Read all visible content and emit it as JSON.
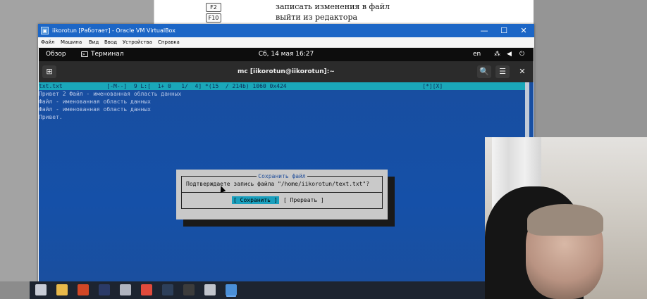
{
  "document": {
    "rows": [
      {
        "key": "F2",
        "desc": "записать изменения в файл"
      },
      {
        "key": "F10",
        "desc": "выйти из редактора"
      }
    ]
  },
  "vbox": {
    "title": "iikorotun [Работает] - Oracle VM VirtualBox",
    "app_icon": "virtualbox-icon",
    "controls": {
      "minimize": "—",
      "maximize": "☐",
      "close": "✕"
    },
    "menu": [
      "Файл",
      "Машина",
      "Вид",
      "Ввод",
      "Устройства",
      "Справка"
    ]
  },
  "gnome": {
    "activities": "Обзор",
    "app_name": "Терминал",
    "clock": "Сб, 14 мая  16:27",
    "lang": "en",
    "icons": {
      "network": "⁂",
      "volume": "◀",
      "power": "⏻"
    }
  },
  "terminal": {
    "title": "mc [iikorotun@iikorotun]:~",
    "new_tab_icon": "⊞",
    "search_icon": "🔍",
    "menu_icon": "☰",
    "close_icon": "✕"
  },
  "editor": {
    "status_bar": "txt.txt             [-M--]  9 L:[  1+ 0   1/  4] *(15  / 214b) 1060 0x424                                        [*][X]",
    "lines": [
      "Привет 2 Файл - именованная область данных",
      "Файл - именованная область данных",
      "Файл - именованная область данных",
      "Привет."
    ]
  },
  "dialog": {
    "title": "Сохранить файл",
    "message": "Подтверждаете запись файла \"/home/iikorotun/text.txt\"?",
    "save_button": "[ Сохранить ]",
    "cancel_button": "[ Прервать ]"
  },
  "taskbar": {
    "icons": [
      "taskview-icon",
      "explorer-icon",
      "powerpoint-icon",
      "photoshop-icon",
      "app-icon",
      "chrome-icon",
      "steam-icon",
      "obs-icon",
      "box-icon",
      "virtualbox-icon"
    ],
    "colors": {
      "taskview-icon": "#c8ccd6",
      "explorer-icon": "#e8b84a",
      "powerpoint-icon": "#d24726",
      "photoshop-icon": "#2b3a67",
      "app-icon": "#b0b4bf",
      "chrome-icon": "#e04a3c",
      "steam-icon": "#2d3f5a",
      "obs-icon": "#3c3c3c",
      "box-icon": "#c0c4cc",
      "virtualbox-icon": "#4a8fd8"
    }
  }
}
